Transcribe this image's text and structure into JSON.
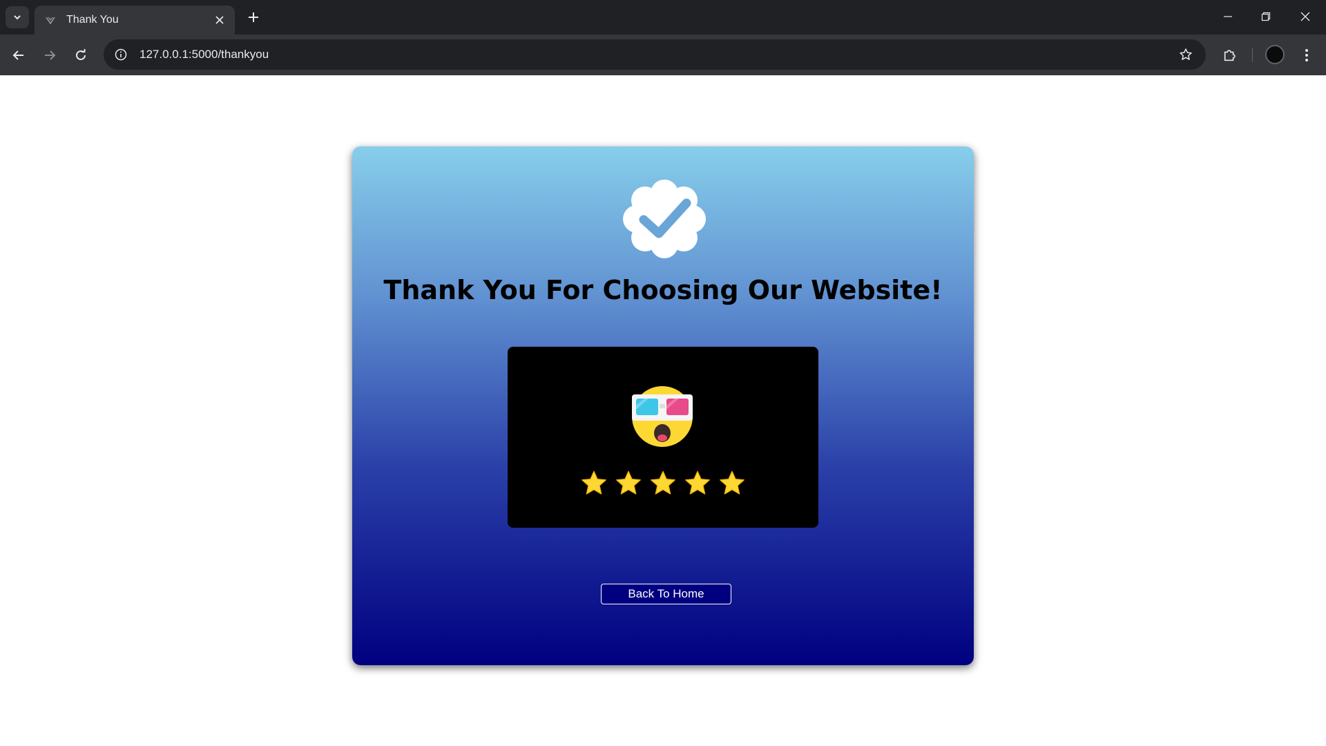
{
  "browser": {
    "tab_title": "Thank You",
    "url": "127.0.0.1:5000/thankyou"
  },
  "page": {
    "heading": "Thank You For Choosing Our Website!",
    "rating": {
      "stars": 5,
      "max_stars": 5
    },
    "back_button_label": "Back To Home",
    "icons": {
      "badge": "verified-check-badge-icon",
      "emoji": "3d-glasses-shocked-face-emoji",
      "star": "star-icon"
    }
  },
  "colors": {
    "gradient_top": "#87ceeb",
    "gradient_bottom": "#000080",
    "button_bg": "#000080",
    "star": "#fdd835"
  }
}
